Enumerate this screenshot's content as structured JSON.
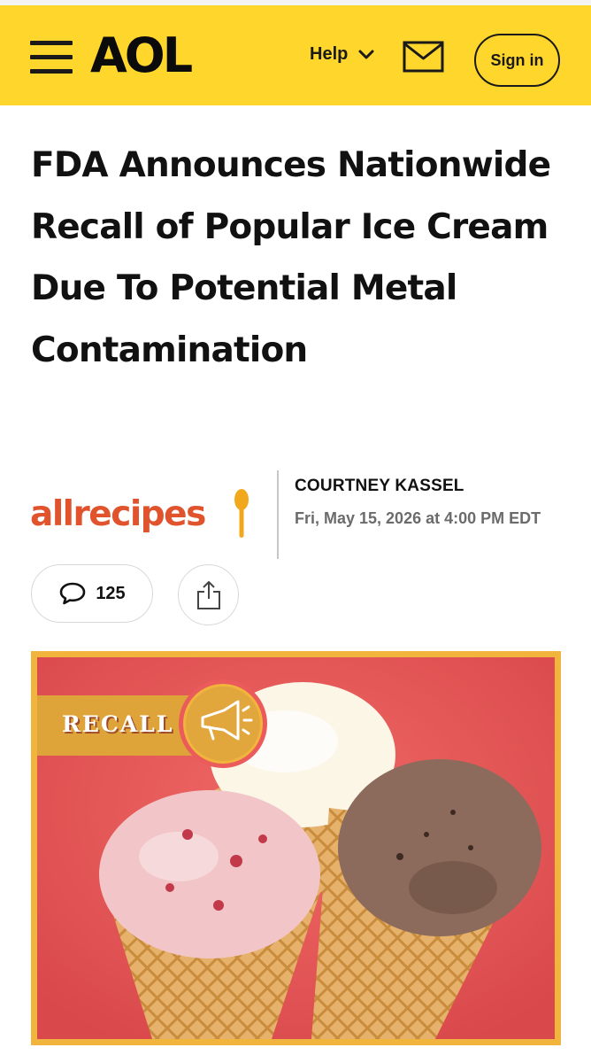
{
  "header": {
    "logo": "AOL",
    "help_label": "Help",
    "signin_label": "Sign in",
    "brand_color": "#ffd62b"
  },
  "article": {
    "headline": "FDA Announces Nationwide Recall of Popular Ice Cream Due To Potential Metal Contamination",
    "source": "allrecipes",
    "author": "COURTNEY KASSEL",
    "date": "Fri, May 15, 2026 at 4:00 PM EDT",
    "comment_count": "125"
  },
  "hero": {
    "badge_text": "RECALL",
    "badge_icon": "megaphone-icon"
  },
  "icons": [
    "menu-icon",
    "chevron-down-icon",
    "mail-icon",
    "comment-icon",
    "share-icon",
    "spoon-icon",
    "megaphone-icon"
  ]
}
